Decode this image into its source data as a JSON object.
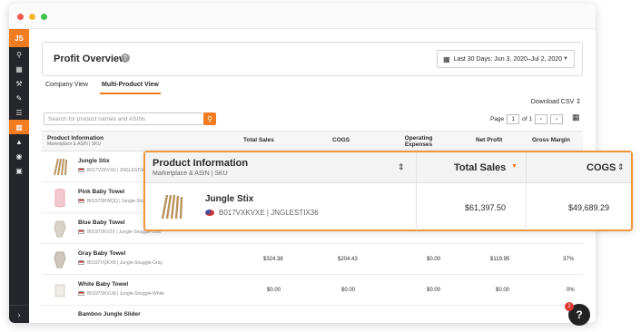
{
  "sidebar": {
    "logo": "JS"
  },
  "header": {
    "title": "Profit Overview",
    "help": "?",
    "date_range": "Last 30 Days: Jun 3, 2020–Jul 2, 2020"
  },
  "tabs": [
    {
      "label": "Company View"
    },
    {
      "label": "Multi-Product View"
    }
  ],
  "toolbar": {
    "download": "Download CSV",
    "search_placeholder": "Search for product names and ASINs",
    "page_label": "Page",
    "page_value": "1",
    "of_label": "of 1"
  },
  "table": {
    "headers": {
      "product": "Product Information",
      "product_sub": "Marketplace & ASIN | SKU",
      "total_sales": "Total Sales",
      "cogs": "COGS",
      "operating_expenses": "Operating Expenses",
      "net_profit": "Net Profit",
      "gross_margin": "Gross Margin"
    },
    "rows": [
      {
        "name": "Jungle Stix",
        "asin": "B017VXKVXE | JNGLESTIX36",
        "total_sales": "",
        "cogs": "",
        "opex": "",
        "net_profit": "",
        "margin": ""
      },
      {
        "name": "Pink Baby Towel",
        "asin": "B0197DKWQQ | Jungle-Snuggle-Pink",
        "total_sales": "",
        "cogs": "",
        "opex": "",
        "net_profit": "",
        "margin": ""
      },
      {
        "name": "Blue Baby Towel",
        "asin": "B0197DKV2X | Jungle-Snuggle-Blue",
        "total_sales": "",
        "cogs": "",
        "opex": "",
        "net_profit": "",
        "margin": ""
      },
      {
        "name": "Gray Baby Towel",
        "asin": "B0197VQKXB | Jungle-Snuggle-Gray",
        "total_sales": "$324.38",
        "cogs": "$204.43",
        "opex": "$0.00",
        "net_profit": "$119.95",
        "margin": "37%"
      },
      {
        "name": "White Baby Towel",
        "asin": "B0197DKVLM | Jungle-Snuggle-White",
        "total_sales": "$0.00",
        "cogs": "$0.00",
        "opex": "$0.00",
        "net_profit": "$0.00",
        "margin": "0%"
      },
      {
        "name": "Bamboo Jungle Slider",
        "asin": "",
        "total_sales": "",
        "cogs": "",
        "opex": "",
        "net_profit": "",
        "margin": ""
      }
    ]
  },
  "overlay": {
    "product_header": "Product Information",
    "product_sub": "Marketplace & ASIN | SKU",
    "total_sales_header": "Total Sales",
    "cogs_header": "COGS",
    "name": "Jungle Stix",
    "asin": "B017VXKVXE | JNGLESTIX36",
    "total_sales": "$61,397.50",
    "cogs": "$49,689.29"
  },
  "help_bubble": {
    "label": "?",
    "badge": "2"
  },
  "colors": {
    "accent": "#f47c20",
    "sidebar": "#25262b"
  }
}
